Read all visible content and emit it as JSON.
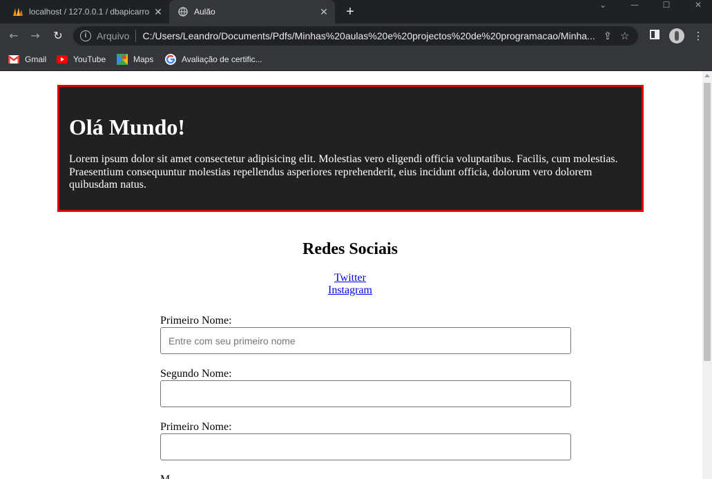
{
  "browser": {
    "tabs": [
      {
        "title": "localhost / 127.0.0.1 / dbapicarro",
        "active": false
      },
      {
        "title": "Aulão",
        "active": true
      }
    ],
    "address": {
      "security_label": "Arquivo",
      "url": "C:/Users/Leandro/Documents/Pdfs/Minhas%20aulas%20e%20projectos%20de%20programacao/Minha..."
    },
    "bookmarks": [
      {
        "label": "Gmail",
        "icon": "gmail-icon"
      },
      {
        "label": "YouTube",
        "icon": "youtube-icon"
      },
      {
        "label": "Maps",
        "icon": "maps-icon"
      },
      {
        "label": "Avaliação de certific...",
        "icon": "google-icon"
      }
    ]
  },
  "page": {
    "hero": {
      "title": "Olá Mundo!",
      "text": "Lorem ipsum dolor sit amet consectetur adipisicing elit. Molestias vero eligendi officia voluptatibus. Facilis, cum molestias. Praesentium consequuntur molestias repellendus asperiores reprehenderit, eius incidunt officia, dolorum vero dolorem quibusdam natus."
    },
    "social": {
      "title": "Redes Sociais",
      "links": [
        "Twitter",
        "Instagram"
      ]
    },
    "form": {
      "fields": [
        {
          "label": "Primeiro Nome:",
          "placeholder": "Entre com seu primeiro nome",
          "value": ""
        },
        {
          "label": "Segundo Nome:",
          "placeholder": "",
          "value": ""
        },
        {
          "label": "Primeiro Nome:",
          "placeholder": "",
          "value": ""
        }
      ],
      "partial_label": "M"
    }
  },
  "colors": {
    "hero_bg": "#212121",
    "hero_border": "#e00000",
    "link": "#0000ee"
  }
}
